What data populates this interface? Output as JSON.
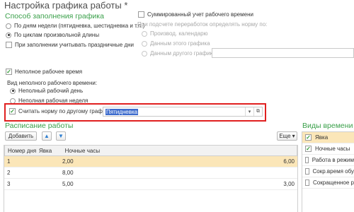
{
  "window": {
    "title": "Настройка графика работы *"
  },
  "fill_method": {
    "title": "Способ заполнения графика",
    "options": [
      {
        "label": "По дням недели (пятидневка, шестидневка и т.п.)",
        "selected": false
      },
      {
        "label": "По циклам произвольной длины",
        "selected": true
      }
    ],
    "holidays_checkbox": {
      "label": "При заполнении учитывать праздничные дни",
      "checked": false
    }
  },
  "summarized": {
    "checkbox_label": "Суммированный учет рабочего времени",
    "checked": false,
    "norm_caption": "При подсчете переработок определять норму по:",
    "options": [
      {
        "label": "Производ. календарю",
        "selected": false
      },
      {
        "label": "Данным этого графика",
        "selected": false
      },
      {
        "label": "Данным другого графика",
        "selected": false
      }
    ],
    "other_schedule_value": ""
  },
  "part_time": {
    "checkbox_label": "Неполное рабочее время",
    "checked": true,
    "type_caption": "Вид неполного рабочего времени:",
    "options": [
      {
        "label": "Неполный рабочий день",
        "selected": true
      },
      {
        "label": "Неполная рабочая неделя",
        "selected": false
      }
    ],
    "norm_other": {
      "checkbox_label": "Считать норму по другому графику:",
      "checked": true,
      "value": "Пятидневка"
    }
  },
  "schedule": {
    "title": "Расписание работы",
    "add_button": "Добавить",
    "more_button": "Еще",
    "columns": [
      "Номер дня",
      "Явка",
      "Ночные часы"
    ],
    "rows": [
      {
        "day": "1",
        "attendance": "2,00",
        "night_hours": "",
        "hours": "6,00",
        "selected": true
      },
      {
        "day": "2",
        "attendance": "8,00",
        "night_hours": "",
        "hours": "",
        "selected": false
      },
      {
        "day": "3",
        "attendance": "5,00",
        "night_hours": "",
        "hours": "3,00",
        "selected": false
      }
    ]
  },
  "time_types": {
    "title": "Виды времени",
    "items": [
      {
        "label": "Явка",
        "checked": true,
        "selected": true
      },
      {
        "label": "Ночные часы",
        "checked": true,
        "selected": false
      },
      {
        "label": "Работа в режим",
        "checked": false,
        "selected": false
      },
      {
        "label": "Сокр.время обу",
        "checked": false,
        "selected": false
      },
      {
        "label": "Сокращенное р",
        "checked": false,
        "selected": false
      }
    ]
  },
  "colors": {
    "accent_green": "#3aa04a",
    "highlight_red": "#e02020",
    "selected_row": "#fbe6b8",
    "selection_blue": "#3d6ccd"
  }
}
